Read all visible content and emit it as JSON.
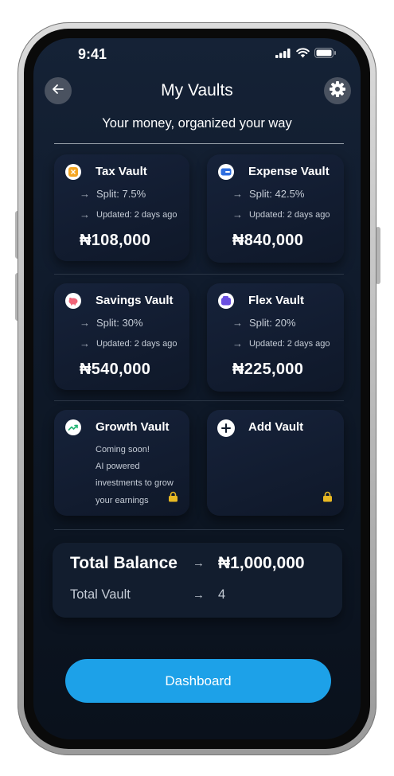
{
  "status_bar": {
    "time": "9:41"
  },
  "header": {
    "title": "My Vaults",
    "subtitle": "Your money, organized your way"
  },
  "vaults": [
    {
      "name": "Tax Vault",
      "split": "Split: 7.5%",
      "updated": "Updated: 2 days ago",
      "amount": "₦108,000",
      "icon": "tax-icon",
      "color": "#f5a623"
    },
    {
      "name": "Expense Vault",
      "split": "Split: 42.5%",
      "updated": "Updated: 2 days ago",
      "amount": "₦840,000",
      "icon": "card-icon",
      "color": "#2f6fe0"
    },
    {
      "name": "Savings Vault",
      "split": "Split: 30%",
      "updated": "Updated: 2 days ago",
      "amount": "₦540,000",
      "icon": "piggy-bank-icon",
      "color": "#f06478"
    },
    {
      "name": "Flex Vault",
      "split": "Split: 20%",
      "updated": "Updated: 2 days ago",
      "amount": "₦225,000",
      "icon": "wallet-icon",
      "color": "#6a4fe0"
    }
  ],
  "growth_vault": {
    "name": "Growth Vault",
    "description": [
      "Coming soon!",
      "AI powered",
      "investments to grow",
      "your earnings"
    ],
    "icon": "trend-up-icon",
    "color": "#22b573"
  },
  "add_vault": {
    "label": "Add Vault"
  },
  "summary": {
    "total_balance_label": "Total Balance",
    "total_balance_value": "₦1,000,000",
    "total_vault_label": "Total Vault",
    "total_vault_value": "4"
  },
  "dashboard_button": {
    "label": "Dashboard"
  },
  "colors": {
    "accent": "#1da1e8",
    "lock": "#e8b923"
  }
}
